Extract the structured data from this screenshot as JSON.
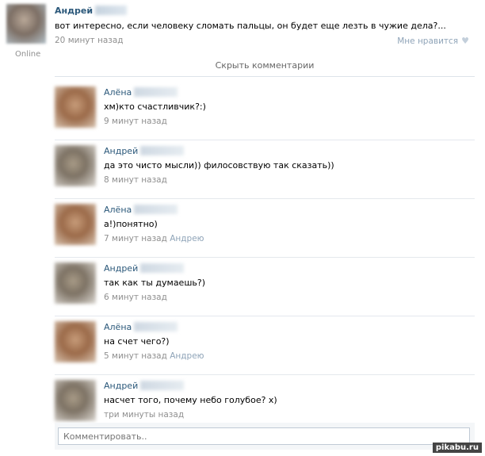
{
  "post": {
    "author": "Андрей",
    "text": "вот интересно, если человеку сломать пальцы, он будет еще лезть в чужие дела?...",
    "time": "20 минут назад",
    "like_label": "Мне нравится",
    "status": "Online"
  },
  "hide_comments_label": "Скрыть комментарии",
  "comments": [
    {
      "author": "Алёна",
      "text": "хм)кто счастливчик?:)",
      "time": "9 минут назад",
      "reply_to": ""
    },
    {
      "author": "Андрей",
      "text": "да это чисто мысли)) филосовствую так сказать))",
      "time": "8 минут назад",
      "reply_to": ""
    },
    {
      "author": "Алёна",
      "text": "а!)понятно)",
      "time": "7 минут назад",
      "reply_to": "Андрею"
    },
    {
      "author": "Андрей",
      "text": "так как ты думаешь?)",
      "time": "6 минут назад",
      "reply_to": ""
    },
    {
      "author": "Алёна",
      "text": "на счет чего?)",
      "time": "5 минут назад",
      "reply_to": "Андрею"
    },
    {
      "author": "Андрей",
      "text": "насчет того, почему небо голубое? x)",
      "time": "три минуты назад",
      "reply_to": ""
    }
  ],
  "comment_input": {
    "placeholder": "Комментировать.."
  },
  "watermark": "pikabu.ru"
}
